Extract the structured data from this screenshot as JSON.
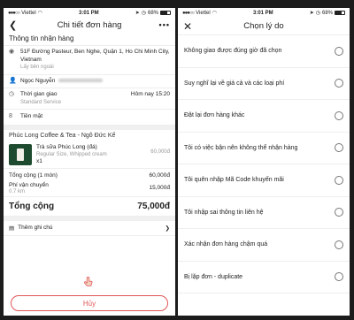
{
  "status": {
    "carrier": "Viettel",
    "time": "3:01 PM",
    "battery": "68%"
  },
  "left": {
    "title": "Chi tiết đơn hàng",
    "more_icon": "•••",
    "section_title": "Thông tin nhận hàng",
    "address": "51F Đường Pasteur, Ben Nghe, Quận 1, Ho Chi Minh City, Vietnam",
    "address_sub": "Lấy bên ngoài",
    "customer_name": "Ngọc Nguyễn",
    "time_label": "Thời gian giao",
    "time_value": "Hôm nay 15:20",
    "time_sub": "Standard Service",
    "payment": "Tiền mặt",
    "shop": "Phúc Long Coffee & Tea - Ngô Đức Kế",
    "item_name": "Trà sữa Phúc Long (đá)",
    "item_opts": "Regular Size, Whipped cream",
    "item_qty": "x1",
    "item_price": "60,000đ",
    "subtotal_label": "Tổng cộng (1 món)",
    "subtotal_value": "60,000đ",
    "ship_label": "Phí vận chuyển",
    "ship_dist": "0.7 km",
    "ship_value": "15,000đ",
    "total_label": "Tổng cộng",
    "total_value": "75,000đ",
    "note_label": "Thêm ghi chú",
    "cancel_label": "Hủy"
  },
  "right": {
    "title": "Chọn lý do",
    "reasons": [
      "Không giao được đúng giờ đã chọn",
      "Suy nghĩ lại về giá cả và các loại phí",
      "Đặt lại đơn hàng khác",
      "Tôi có việc bận nên không thể nhận hàng",
      "Tôi quên nhập Mã Code khuyến mãi",
      "Tôi nhập sai thông tin liên hệ",
      "Xác nhận đơn hàng chậm quá",
      "Bị lặp đơn - duplicate"
    ]
  },
  "colors": {
    "accent": "#e05555",
    "muted": "#9a9a9a"
  }
}
